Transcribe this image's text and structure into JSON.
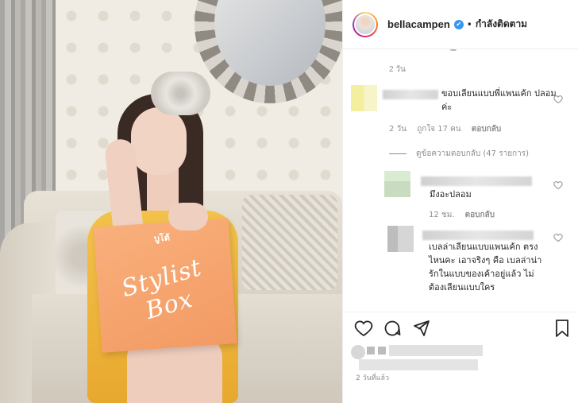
{
  "post": {
    "box_brand": "บูโต้",
    "box_title": "Stylist Box"
  },
  "header": {
    "username": "bellacampen",
    "verified_icon": "✔",
    "separator": "•",
    "follow_status": "กำลังติดตาม"
  },
  "comments": {
    "previous_meta": "2 วัน",
    "items": [
      {
        "text": "ขอบเลียนแบบพี่แพนเค้ก ปลอมค่ะ",
        "time": "2 วัน",
        "likes": "ถูกใจ 17 คน",
        "reply": "ตอบกลับ",
        "view_replies": "ดูข้อความตอบกลับ (47 รายการ)"
      },
      {
        "text": "มึงอะปลอม",
        "time": "12 ชม.",
        "reply": "ตอบกลับ"
      },
      {
        "text": "เบลล่าเลียนแบบแพนเค้ก ตรงไหนคะ เอาจริงๆ คือ เบลล่าน่ารักในแบบของเค้าอยู่แล้ว ไม่ต้องเลียนแบบใคร"
      }
    ]
  },
  "footer": {
    "timestamp": "2 วันที่แล้ว"
  },
  "colors": {
    "accent": "#3897f0",
    "muted_text": "#8e8e8e",
    "box_orange": "#f39a63"
  }
}
